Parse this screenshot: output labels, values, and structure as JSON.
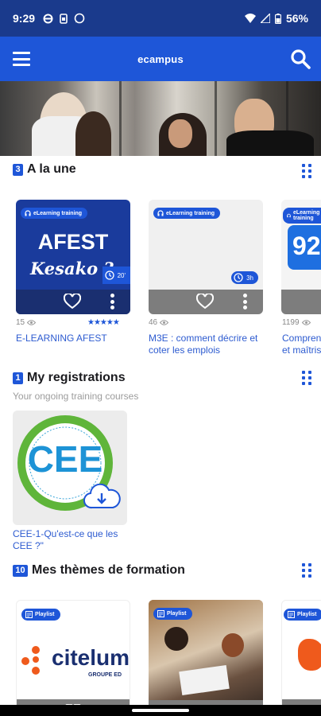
{
  "status": {
    "time": "9:29",
    "battery": "56%"
  },
  "appbar": {
    "title": "ecampus"
  },
  "sections": {
    "a_la_une": {
      "count": "3",
      "title": "A la une"
    },
    "registrations": {
      "count": "1",
      "title": "My registrations",
      "subtitle": "Your ongoing training courses"
    },
    "themes": {
      "count": "10",
      "title": "Mes thèmes de formation"
    }
  },
  "featured": [
    {
      "tag": "eLearning training",
      "image_text_1": "AFEST",
      "image_text_2": "Kesako ?",
      "duration": "20'",
      "views": "15",
      "title": "E-LEARNING AFEST",
      "rating": 5
    },
    {
      "tag": "eLearning training",
      "duration": "3h",
      "views": "46",
      "title": "M3E : comment décrire et coter les emplois"
    },
    {
      "tag": "eLearning training",
      "image_text": "92",
      "views": "1199",
      "title": "Compren et maîtris"
    }
  ],
  "registration": {
    "title": "CEE-1-Qu'est-ce que les CEE ?\"",
    "logo_text": "CEE"
  },
  "themes": [
    {
      "tag": "Playlist",
      "logo_text": "citelum",
      "logo_sub": "GROUPE ED"
    },
    {
      "tag": "Playlist"
    },
    {
      "tag": "Playlist"
    }
  ],
  "colors": {
    "primary": "#1e56d8",
    "statusbar": "#1a3a8c",
    "link": "#2d5bd0"
  }
}
